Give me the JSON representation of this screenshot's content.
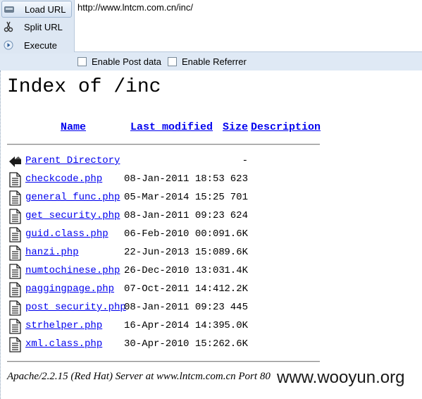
{
  "toolbar": {
    "load_label": "Load URL",
    "split_label": "Split URL",
    "execute_label": "Execute",
    "url_value": "http://www.lntcm.com.cn/inc/",
    "post_label": "Enable Post data",
    "referrer_label": "Enable Referrer"
  },
  "listing": {
    "title": "Index of /inc",
    "headers": {
      "name": "Name",
      "modified": "Last modified",
      "size": "Size",
      "description": "Description"
    },
    "rows": [
      {
        "icon": "back-arrow-icon",
        "name": "Parent Directory",
        "date": "",
        "size": "-"
      },
      {
        "icon": "file-icon",
        "name": "checkcode.php",
        "date": "08-Jan-2011 18:53",
        "size": "623"
      },
      {
        "icon": "file-icon",
        "name": "general_func.php",
        "date": "05-Mar-2014 15:25",
        "size": "701"
      },
      {
        "icon": "file-icon",
        "name": "get_security.php",
        "date": "08-Jan-2011 09:23",
        "size": "624"
      },
      {
        "icon": "file-icon",
        "name": "guid.class.php",
        "date": "06-Feb-2010 00:09",
        "size": "1.6K"
      },
      {
        "icon": "file-icon",
        "name": "hanzi.php",
        "date": "22-Jun-2013 15:08",
        "size": "9.6K"
      },
      {
        "icon": "file-icon",
        "name": "numtochinese.php",
        "date": "26-Dec-2010 13:03",
        "size": "1.4K"
      },
      {
        "icon": "file-icon",
        "name": "paggingpage.php",
        "date": "07-Oct-2011 14:41",
        "size": "2.2K"
      },
      {
        "icon": "file-icon",
        "name": "post_security.php",
        "date": "08-Jan-2011 09:23",
        "size": "445"
      },
      {
        "icon": "file-icon",
        "name": "strhelper.php",
        "date": "16-Apr-2014 14:39",
        "size": "5.0K"
      },
      {
        "icon": "file-icon",
        "name": "xml.class.php",
        "date": "30-Apr-2010 15:26",
        "size": "2.6K"
      }
    ],
    "address": "Apache/2.2.15 (Red Hat) Server at www.lntcm.com.cn Port 80"
  },
  "watermark": "www.wooyun.org",
  "colors": {
    "link": "#0000ee",
    "toolbar_bg": "#dfe9f5"
  }
}
